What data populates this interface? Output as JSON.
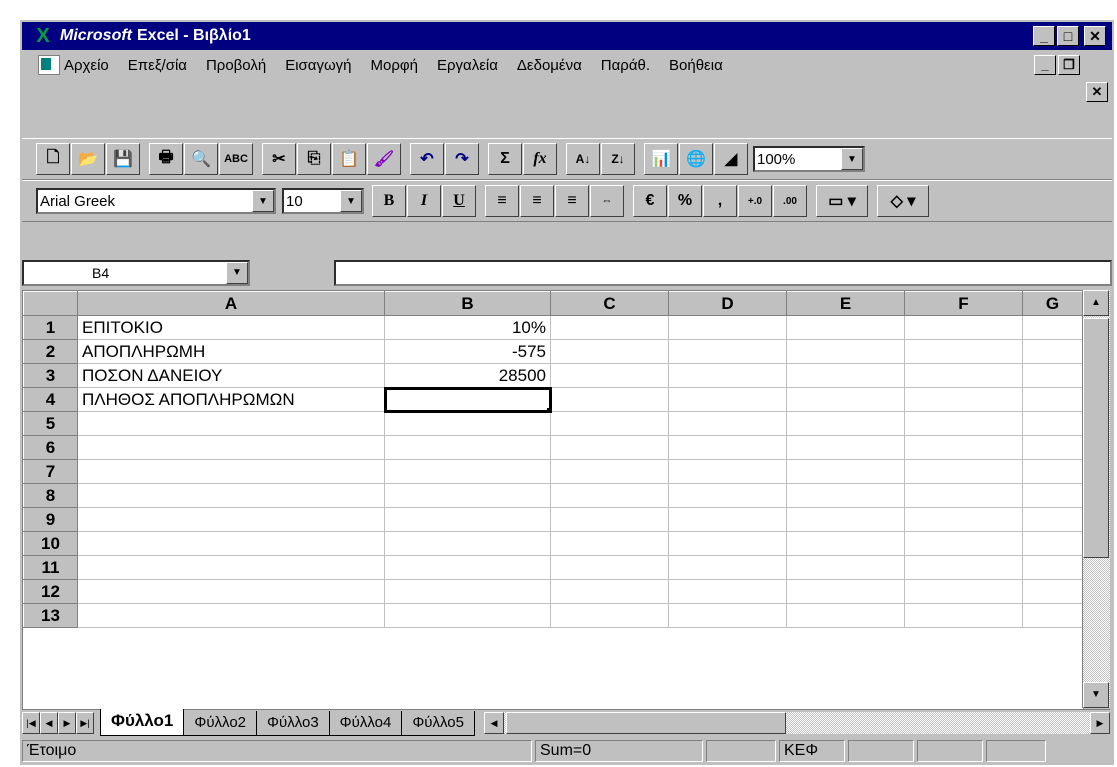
{
  "window": {
    "title_ms": "Microsoft",
    "title_rest": "Excel - Βιβλίο1"
  },
  "menu": [
    {
      "label": "Αρχείο"
    },
    {
      "label": "Επεξ/σία"
    },
    {
      "label": "Προβολή"
    },
    {
      "label": "Εισαγωγή"
    },
    {
      "label": "Μορφή"
    },
    {
      "label": "Εργαλεία"
    },
    {
      "label": "Δεδομένα"
    },
    {
      "label": "Παράθ."
    },
    {
      "label": "Βοήθεια"
    }
  ],
  "toolbar": {
    "zoom": "100%",
    "font": "Arial Greek",
    "font_size": "10",
    "bold": "B",
    "italic": "I",
    "underline": "U",
    "percent": "%",
    "comma": ",",
    "sum": "Σ",
    "fx": "fx"
  },
  "formula_bar": {
    "name_box": "B4",
    "formula": ""
  },
  "grid": {
    "columns": [
      "A",
      "B",
      "C",
      "D",
      "E",
      "F",
      "G"
    ],
    "rows": [
      {
        "n": "1",
        "a": "ΕΠΙΤΟΚΙΟ",
        "b": "10%"
      },
      {
        "n": "2",
        "a": "ΑΠΟΠΛΗΡΩΜΗ",
        "b": "-575"
      },
      {
        "n": "3",
        "a": "ΠΟΣΟΝ ΔΑΝΕΙΟΥ",
        "b": "28500"
      },
      {
        "n": "4",
        "a": "ΠΛΗΘΟΣ ΑΠΟΠΛΗΡΩΜΩΝ",
        "b": ""
      },
      {
        "n": "5",
        "a": "",
        "b": ""
      },
      {
        "n": "6",
        "a": "",
        "b": ""
      },
      {
        "n": "7",
        "a": "",
        "b": ""
      },
      {
        "n": "8",
        "a": "",
        "b": ""
      },
      {
        "n": "9",
        "a": "",
        "b": ""
      },
      {
        "n": "10",
        "a": "",
        "b": ""
      },
      {
        "n": "11",
        "a": "",
        "b": ""
      },
      {
        "n": "12",
        "a": "",
        "b": ""
      },
      {
        "n": "13",
        "a": "",
        "b": ""
      }
    ]
  },
  "sheets": [
    "Φύλλο1",
    "Φύλλο2",
    "Φύλλο3",
    "Φύλλο4",
    "Φύλλο5"
  ],
  "status": {
    "ready": "Έτοιμο",
    "sum": "Sum=0",
    "kef": "ΚΕΦ"
  }
}
